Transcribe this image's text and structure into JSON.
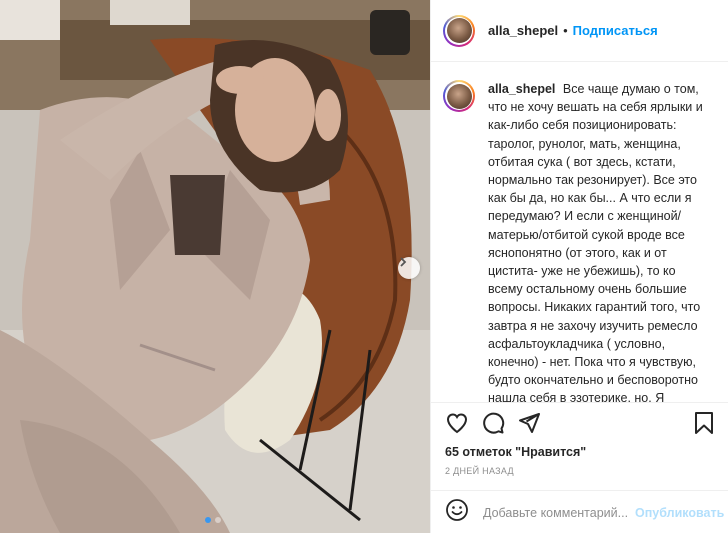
{
  "post": {
    "photo": {
      "alt_icon": "photo-of-woman-in-chair",
      "next_icon": "chevron-right-icon",
      "carousel_count": 2,
      "carousel_active": 1
    },
    "header": {
      "username": "alla_shepel",
      "separator": "•",
      "follow_label": "Подписаться"
    },
    "caption": {
      "username": "alla_shepel",
      "text": "Все чаще думаю о том, что не хочу вешать на себя ярлыки и как-либо себя позиционировать: таролог, рунолог, мать, женщина, отбитая сука ( вот здесь, кстати, нормально так резонирует). Все это как бы да, но как бы... А что если я передумаю? И если с женщиной/матерью/отбитой сукой вроде все яснопонятно (от этого, как и от цистита- уже не убежишь), то ко всему остальному очень большие вопросы. Никаких гарантий того, что завтра я не захочу изучить ремесло асфальтоукладчика ( условно, конечно) - нет. Пока что я чувствую, будто окончательно и бесповоротно нашла себя в эзотерике, но. Я безумно люблю сам процесс «поиска» и куда он"
    },
    "actions": {
      "like_icon": "heart-icon",
      "comment_icon": "comment-icon",
      "share_icon": "share-icon",
      "save_icon": "bookmark-icon",
      "likes_text": "65 отметок \"Нравится\"",
      "time_ago": "2 дней назад"
    },
    "comment": {
      "emoji_icon": "smiley-icon",
      "placeholder": "Добавьте комментарий...",
      "publish_label": "Опубликовать"
    },
    "colors": {
      "accent": "#0095f6",
      "publish_disabled": "#b2dffc",
      "muted": "#8e8e8e",
      "border": "#efefef"
    }
  }
}
